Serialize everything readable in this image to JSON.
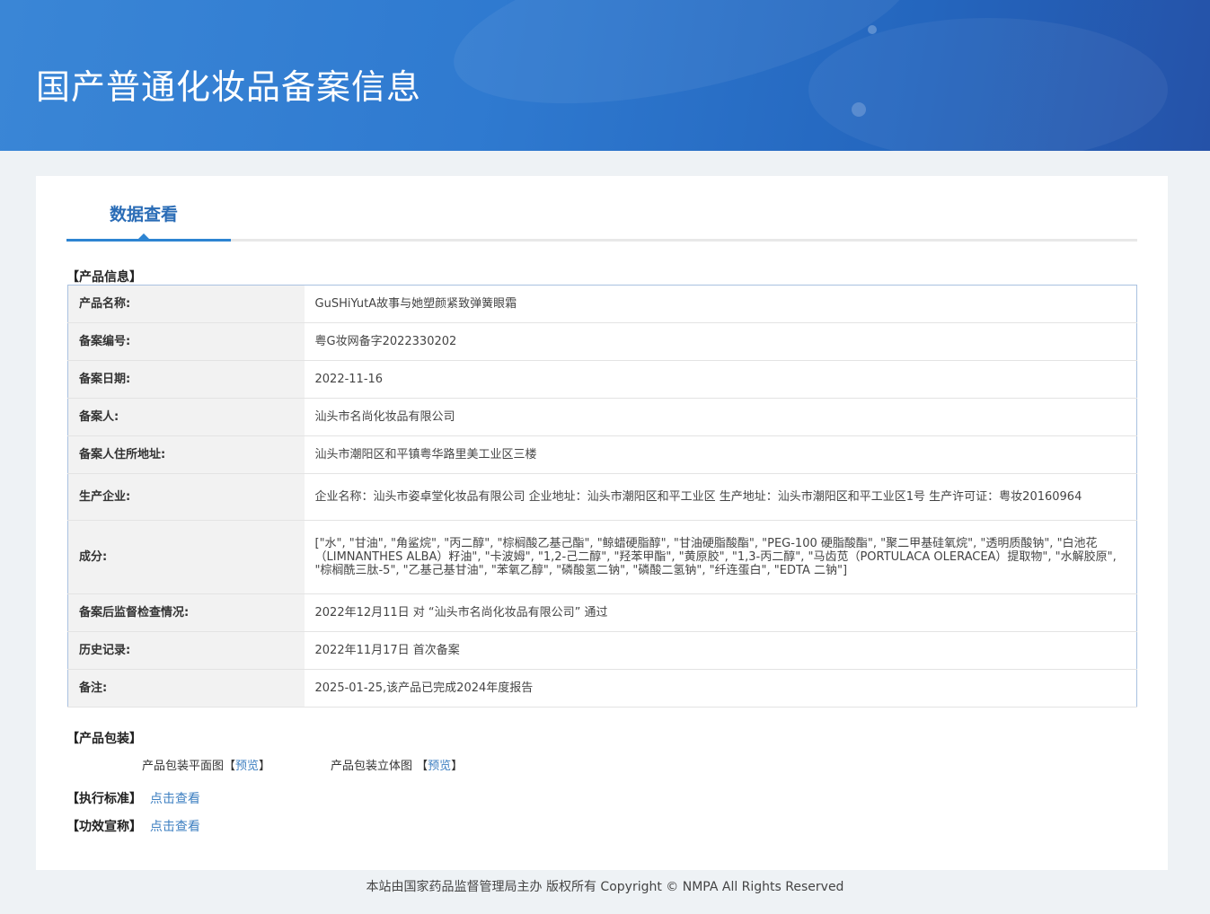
{
  "header": {
    "title": "国产普通化妆品备案信息"
  },
  "tab": {
    "label": "数据查看"
  },
  "sections": {
    "product_info": "【产品信息】",
    "packaging": "【产品包装】",
    "standard": "【执行标准】",
    "efficacy": "【功效宣称】"
  },
  "rows": [
    {
      "label": "产品名称:",
      "value": "GuSHiYutA故事与她塑颜紧致弹簧眼霜"
    },
    {
      "label": "备案编号:",
      "value": "粤G妆网备字2022330202"
    },
    {
      "label": "备案日期:",
      "value": "2022-11-16"
    },
    {
      "label": "备案人:",
      "value": "汕头市名尚化妆品有限公司"
    },
    {
      "label": "备案人住所地址:",
      "value": "汕头市潮阳区和平镇粤华路里美工业区三楼"
    },
    {
      "label": "生产企业:",
      "value": "企业名称：汕头市姿卓堂化妆品有限公司 企业地址：汕头市潮阳区和平工业区 生产地址：汕头市潮阳区和平工业区1号 生产许可证：粤妆20160964"
    },
    {
      "label": "成分:",
      "value": "[\"水\", \"甘油\", \"角鲨烷\", \"丙二醇\", \"棕榈酸乙基己酯\", \"鲸蜡硬脂醇\", \"甘油硬脂酸酯\", \"PEG-100 硬脂酸酯\", \"聚二甲基硅氧烷\", \"透明质酸钠\", \"白池花（LIMNANTHES ALBA）籽油\", \"卡波姆\", \"1,2-己二醇\", \"羟苯甲酯\", \"黄原胶\", \"1,3-丙二醇\", \"马齿苋（PORTULACA OLERACEA）提取物\", \"水解胶原\", \"棕榈酰三肽-5\", \"乙基己基甘油\", \"苯氧乙醇\", \"磷酸氢二钠\", \"磷酸二氢钠\", \"纤连蛋白\", \"EDTA 二钠\"]"
    },
    {
      "label": "备案后监督检查情况:",
      "value": "2022年12月11日 对 “汕头市名尚化妆品有限公司” 通过"
    },
    {
      "label": "历史记录:",
      "value": "2022年11月17日 首次备案"
    },
    {
      "label": "备注:",
      "value": "2025-01-25,该产品已完成2024年度报告"
    }
  ],
  "packaging": {
    "flat_label": "产品包装平面图",
    "solid_label": "产品包装立体图",
    "preview": "预览",
    "bracket_open": "【",
    "bracket_close": "】"
  },
  "links": {
    "view": "点击查看"
  },
  "footer": "本站由国家药品监督管理局主办 版权所有 Copyright © NMPA All Rights Reserved"
}
